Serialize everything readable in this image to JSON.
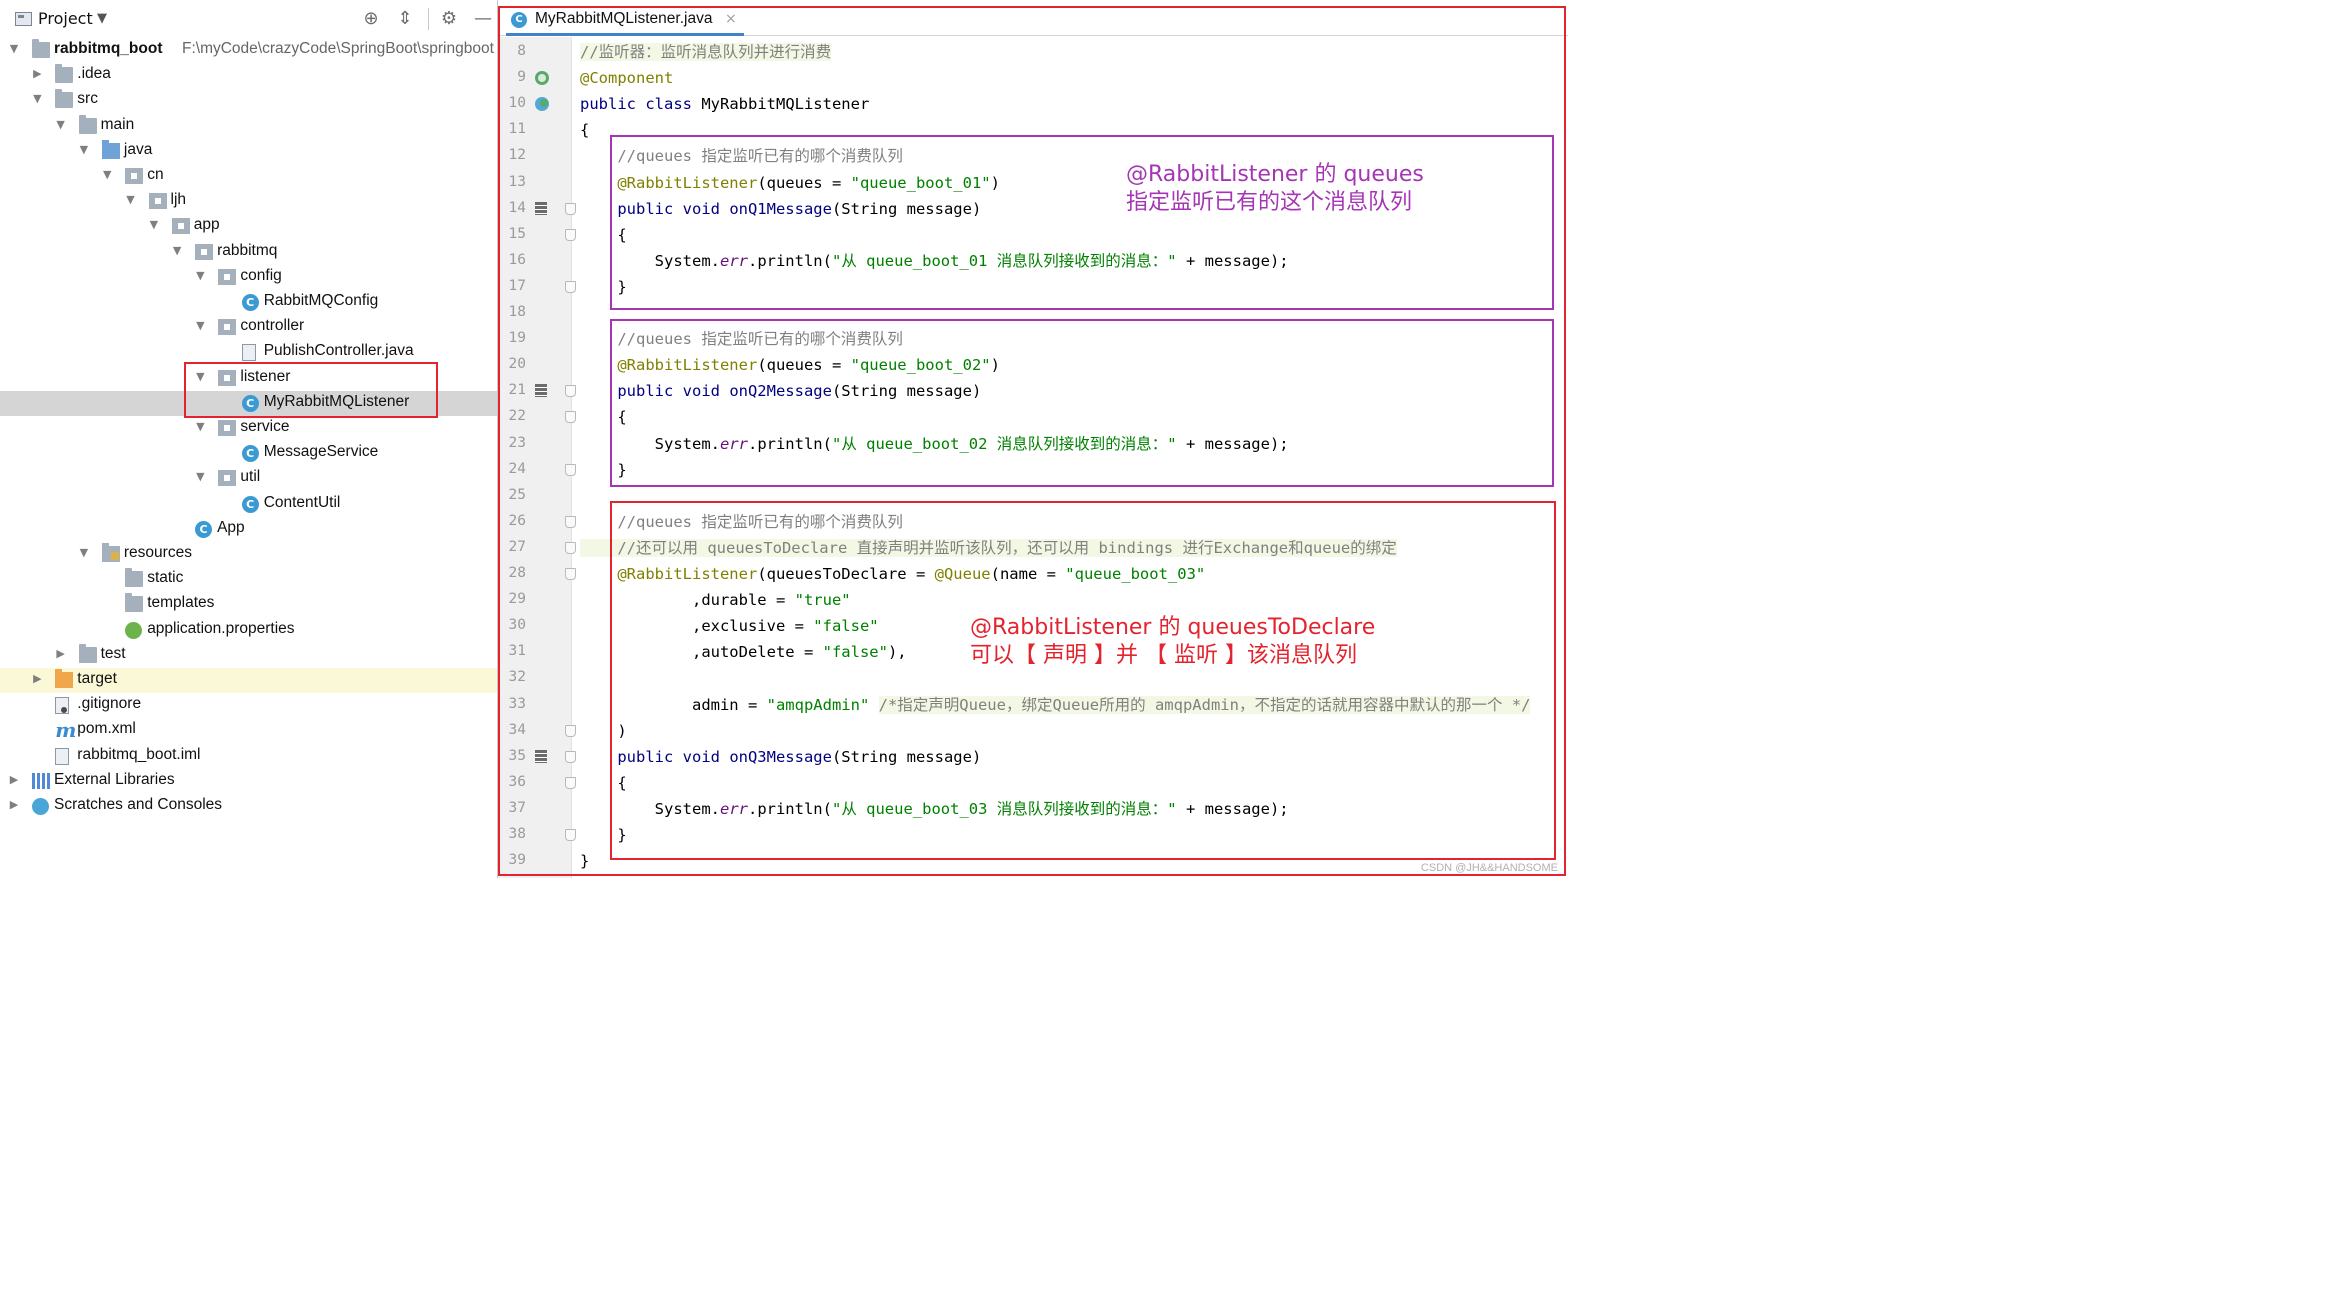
{
  "project_panel": {
    "title": "Project",
    "toolbar_icons": [
      "locate-icon",
      "collapse-icon",
      "gear-icon",
      "minimize-icon"
    ],
    "tree": [
      {
        "label": "rabbitmq_boot",
        "path": "F:\\myCode\\crazyCode\\SpringBoot\\springboot",
        "icon": "module-folder",
        "expanded": true,
        "bold": true
      },
      {
        "label": ".idea",
        "icon": "folder",
        "expanded": false
      },
      {
        "label": "src",
        "icon": "folder",
        "expanded": true
      },
      {
        "label": "main",
        "icon": "folder",
        "expanded": true
      },
      {
        "label": "java",
        "icon": "source-folder",
        "expanded": true
      },
      {
        "label": "cn",
        "icon": "package",
        "expanded": true
      },
      {
        "label": "ljh",
        "icon": "package",
        "expanded": true
      },
      {
        "label": "app",
        "icon": "package",
        "expanded": true
      },
      {
        "label": "rabbitmq",
        "icon": "package",
        "expanded": true
      },
      {
        "label": "config",
        "icon": "package",
        "expanded": true
      },
      {
        "label": "RabbitMQConfig",
        "icon": "class"
      },
      {
        "label": "controller",
        "icon": "package",
        "expanded": true
      },
      {
        "label": "PublishController.java",
        "icon": "java-file"
      },
      {
        "label": "listener",
        "icon": "package",
        "expanded": true
      },
      {
        "label": "MyRabbitMQListener",
        "icon": "class",
        "selected": true
      },
      {
        "label": "service",
        "icon": "package",
        "expanded": true
      },
      {
        "label": "MessageService",
        "icon": "class"
      },
      {
        "label": "util",
        "icon": "package",
        "expanded": true
      },
      {
        "label": "ContentUtil",
        "icon": "class"
      },
      {
        "label": "App",
        "icon": "spring-class"
      },
      {
        "label": "resources",
        "icon": "resources-folder",
        "expanded": true
      },
      {
        "label": "static",
        "icon": "folder"
      },
      {
        "label": "templates",
        "icon": "folder"
      },
      {
        "label": "application.properties",
        "icon": "properties-file"
      },
      {
        "label": "test",
        "icon": "folder",
        "expanded": false
      },
      {
        "label": "target",
        "icon": "excluded-folder",
        "expanded": false
      },
      {
        "label": ".gitignore",
        "icon": "gitignore-file"
      },
      {
        "label": "pom.xml",
        "icon": "maven-file"
      },
      {
        "label": "rabbitmq_boot.iml",
        "icon": "iml-file"
      },
      {
        "label": "External Libraries",
        "icon": "libraries",
        "expanded": false
      },
      {
        "label": "Scratches and Consoles",
        "icon": "scratches",
        "expanded": false
      }
    ]
  },
  "editor": {
    "tab": {
      "label": "MyRabbitMQListener.java",
      "icon": "class-icon",
      "close": "×"
    },
    "lines": [
      {
        "n": "8",
        "segs": [
          {
            "t": "//监听器：监听消息队列并进行消费",
            "c": "cm bg-comment"
          }
        ]
      },
      {
        "n": "9",
        "segs": [
          {
            "t": "@Component",
            "c": "ann"
          }
        ]
      },
      {
        "n": "10",
        "segs": [
          {
            "t": "public class ",
            "c": "kw"
          },
          {
            "t": "MyRabbitMQListener",
            "c": ""
          }
        ]
      },
      {
        "n": "11",
        "segs": [
          {
            "t": "{",
            "c": ""
          }
        ]
      },
      {
        "n": "12",
        "segs": [
          {
            "t": "    //queues 指定监听已有的哪个消费队列",
            "c": "cm"
          }
        ]
      },
      {
        "n": "13",
        "segs": [
          {
            "t": "    ",
            "c": ""
          },
          {
            "t": "@RabbitListener",
            "c": "ann"
          },
          {
            "t": "(queues = ",
            "c": ""
          },
          {
            "t": "\"queue_boot_01\"",
            "c": "str"
          },
          {
            "t": ")",
            "c": ""
          }
        ]
      },
      {
        "n": "14",
        "segs": [
          {
            "t": "    ",
            "c": ""
          },
          {
            "t": "public void ",
            "c": "kw"
          },
          {
            "t": "onQ1Message",
            "c": "kw"
          },
          {
            "t": "(String message)",
            "c": ""
          }
        ]
      },
      {
        "n": "15",
        "segs": [
          {
            "t": "    {",
            "c": ""
          }
        ]
      },
      {
        "n": "16",
        "segs": [
          {
            "t": "        System.",
            "c": ""
          },
          {
            "t": "err",
            "c": "it"
          },
          {
            "t": ".println(",
            "c": ""
          },
          {
            "t": "\"从 queue_boot_01 消息队列接收到的消息：\"",
            "c": "str"
          },
          {
            "t": " + message);",
            "c": ""
          }
        ]
      },
      {
        "n": "17",
        "segs": [
          {
            "t": "    }",
            "c": ""
          }
        ]
      },
      {
        "n": "18",
        "segs": []
      },
      {
        "n": "19",
        "segs": [
          {
            "t": "    //queues 指定监听已有的哪个消费队列",
            "c": "cm"
          }
        ]
      },
      {
        "n": "20",
        "segs": [
          {
            "t": "    ",
            "c": ""
          },
          {
            "t": "@RabbitListener",
            "c": "ann"
          },
          {
            "t": "(queues = ",
            "c": ""
          },
          {
            "t": "\"queue_boot_02\"",
            "c": "str"
          },
          {
            "t": ")",
            "c": ""
          }
        ]
      },
      {
        "n": "21",
        "segs": [
          {
            "t": "    ",
            "c": ""
          },
          {
            "t": "public void ",
            "c": "kw"
          },
          {
            "t": "onQ2Message",
            "c": "kw"
          },
          {
            "t": "(String message)",
            "c": ""
          }
        ]
      },
      {
        "n": "22",
        "segs": [
          {
            "t": "    {",
            "c": ""
          }
        ]
      },
      {
        "n": "23",
        "segs": [
          {
            "t": "        System.",
            "c": ""
          },
          {
            "t": "err",
            "c": "it"
          },
          {
            "t": ".println(",
            "c": ""
          },
          {
            "t": "\"从 queue_boot_02 消息队列接收到的消息：\"",
            "c": "str"
          },
          {
            "t": " + message);",
            "c": ""
          }
        ]
      },
      {
        "n": "24",
        "segs": [
          {
            "t": "    }",
            "c": ""
          }
        ]
      },
      {
        "n": "25",
        "segs": []
      },
      {
        "n": "26",
        "segs": [
          {
            "t": "    //queues 指定监听已有的哪个消费队列",
            "c": "cm"
          }
        ]
      },
      {
        "n": "27",
        "segs": [
          {
            "t": "    //还可以用 queuesToDeclare 直接声明并监听该队列，还可以用 bindings 进行Exchange和queue的绑定",
            "c": "cm bg-comment"
          }
        ]
      },
      {
        "n": "28",
        "segs": [
          {
            "t": "    ",
            "c": ""
          },
          {
            "t": "@RabbitListener",
            "c": "ann"
          },
          {
            "t": "(queuesToDeclare = ",
            "c": ""
          },
          {
            "t": "@Queue",
            "c": "ann"
          },
          {
            "t": "(name = ",
            "c": ""
          },
          {
            "t": "\"queue_boot_03\"",
            "c": "str"
          }
        ]
      },
      {
        "n": "29",
        "segs": [
          {
            "t": "            ,durable = ",
            "c": ""
          },
          {
            "t": "\"true\"",
            "c": "str"
          }
        ]
      },
      {
        "n": "30",
        "segs": [
          {
            "t": "            ,exclusive = ",
            "c": ""
          },
          {
            "t": "\"false\"",
            "c": "str"
          }
        ]
      },
      {
        "n": "31",
        "segs": [
          {
            "t": "            ,autoDelete = ",
            "c": ""
          },
          {
            "t": "\"false\"",
            "c": "str"
          },
          {
            "t": "),",
            "c": ""
          }
        ]
      },
      {
        "n": "32",
        "segs": []
      },
      {
        "n": "33",
        "segs": [
          {
            "t": "            admin = ",
            "c": ""
          },
          {
            "t": "\"amqpAdmin\"",
            "c": "str"
          },
          {
            "t": " ",
            "c": ""
          },
          {
            "t": "/*指定声明Queue，绑定Queue所用的 amqpAdmin，不指定的话就用容器中默认的那一个 */",
            "c": "cm bg-comment"
          }
        ]
      },
      {
        "n": "34",
        "segs": [
          {
            "t": "    )",
            "c": ""
          }
        ]
      },
      {
        "n": "35",
        "segs": [
          {
            "t": "    ",
            "c": ""
          },
          {
            "t": "public void ",
            "c": "kw"
          },
          {
            "t": "onQ3Message",
            "c": "kw"
          },
          {
            "t": "(String message)",
            "c": ""
          }
        ]
      },
      {
        "n": "36",
        "segs": [
          {
            "t": "    {",
            "c": ""
          }
        ]
      },
      {
        "n": "37",
        "segs": [
          {
            "t": "        System.",
            "c": ""
          },
          {
            "t": "err",
            "c": "it"
          },
          {
            "t": ".println(",
            "c": ""
          },
          {
            "t": "\"从 queue_boot_03 消息队列接收到的消息：\"",
            "c": "str"
          },
          {
            "t": " + message);",
            "c": ""
          }
        ]
      },
      {
        "n": "38",
        "segs": [
          {
            "t": "    }",
            "c": ""
          }
        ]
      },
      {
        "n": "39",
        "segs": [
          {
            "t": "}",
            "c": ""
          }
        ]
      }
    ],
    "gutter_icons": {
      "9": "spring-bean-icon",
      "10": "spring-bean-icon",
      "14": "run-stack-icon",
      "21": "run-stack-icon",
      "35": "run-stack-icon"
    }
  },
  "annotations": {
    "note1_line1": "@RabbitListener 的 queues",
    "note1_line2": "指定监听已有的这个消息队列",
    "note2_line1": "@RabbitListener 的 queuesToDeclare",
    "note2_line2": "可以【 声明 】并 【 监听 】该消息队列",
    "note1_color": "#a535b5",
    "note2_color": "#e3232d",
    "box_purple_color": "#a535b5",
    "box_red_color": "#e3232d"
  },
  "watermark": "CSDN @JH&&HANDSOME"
}
